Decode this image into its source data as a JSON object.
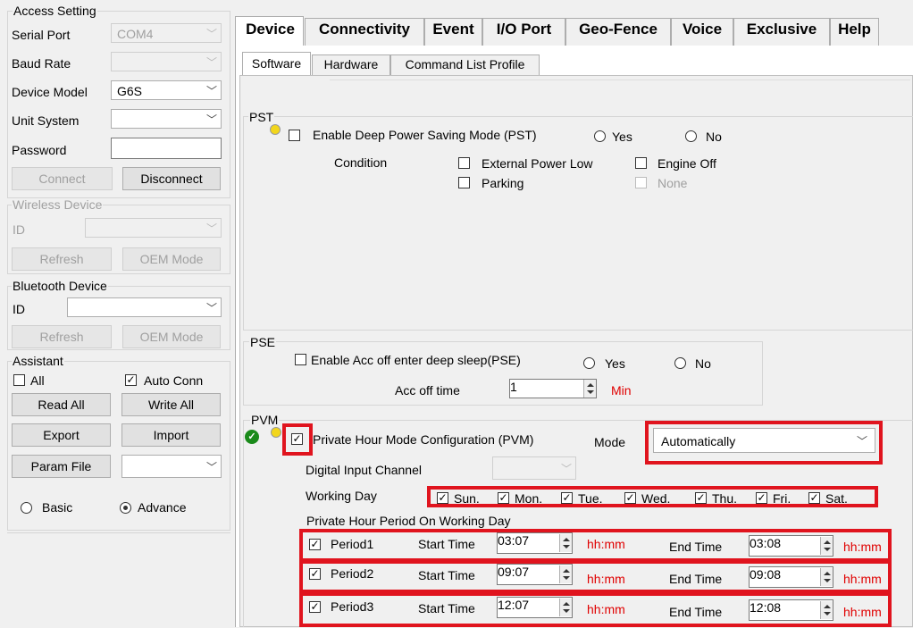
{
  "access": {
    "group_title": "Access Setting",
    "serial_port_label": "Serial Port",
    "serial_port_value": "COM4",
    "baud_rate_label": "Baud Rate",
    "baud_rate_value": "",
    "device_model_label": "Device Model",
    "device_model_value": "G6S",
    "unit_system_label": "Unit System",
    "unit_system_value": "",
    "password_label": "Password",
    "password_value": "",
    "connect": "Connect",
    "disconnect": "Disconnect"
  },
  "wireless": {
    "group_title": "Wireless Device",
    "id_label": "ID",
    "refresh": "Refresh",
    "oem_mode": "OEM Mode"
  },
  "bluetooth": {
    "group_title": "Bluetooth Device",
    "id_label": "ID",
    "refresh": "Refresh",
    "oem_mode": "OEM Mode"
  },
  "assistant": {
    "group_title": "Assistant",
    "all_label": "All",
    "all_checked": false,
    "auto_conn_label": "Auto Conn",
    "auto_conn_checked": true,
    "read_all": "Read All",
    "write_all": "Write All",
    "export": "Export",
    "import": "Import",
    "param_file": "Param File",
    "basic": "Basic",
    "advance": "Advance",
    "mode_selected": "Advance"
  },
  "tabs": [
    "Device",
    "Connectivity",
    "Event",
    "I/O Port",
    "Geo-Fence",
    "Voice",
    "Exclusive",
    "Help"
  ],
  "active_tab": "Device",
  "subtabs": [
    "Software",
    "Hardware",
    "Command List Profile"
  ],
  "active_subtab": "Software",
  "pst": {
    "title": "PST",
    "enable_label": "Enable Deep Power Saving Mode (PST)",
    "yes": "Yes",
    "no": "No",
    "condition_label": "Condition",
    "external_power_low": "External Power Low",
    "engine_off": "Engine Off",
    "parking": "Parking",
    "none": "None"
  },
  "pse": {
    "title": "PSE",
    "enable_label": "Enable Acc off enter deep sleep(PSE)",
    "yes": "Yes",
    "no": "No",
    "acc_off_time_label": "Acc off time",
    "acc_off_time_value": "1",
    "unit": "Min"
  },
  "pvm": {
    "title": "PVM",
    "enable_label": "Private Hour Mode Configuration (PVM)",
    "enabled": true,
    "mode_label": "Mode",
    "mode_value": "Automatically",
    "digital_input_label": "Digital Input Channel",
    "working_day_label": "Working Day",
    "days": [
      "Sun.",
      "Mon.",
      "Tue.",
      "Wed.",
      "Thu.",
      "Fri.",
      "Sat."
    ],
    "period_header": "Private Hour Period On Working Day",
    "start_time_label": "Start Time",
    "end_time_label": "End Time",
    "time_unit": "hh:mm",
    "periods": [
      {
        "name": "Period1",
        "start": "03:07",
        "end": "03:08"
      },
      {
        "name": "Period2",
        "start": "09:07",
        "end": "09:08"
      },
      {
        "name": "Period3",
        "start": "12:07",
        "end": "12:08"
      }
    ]
  },
  "colors": {
    "highlight": "#e0141e",
    "unit_text": "#e00000",
    "check_ok": "#1a8a1a"
  }
}
